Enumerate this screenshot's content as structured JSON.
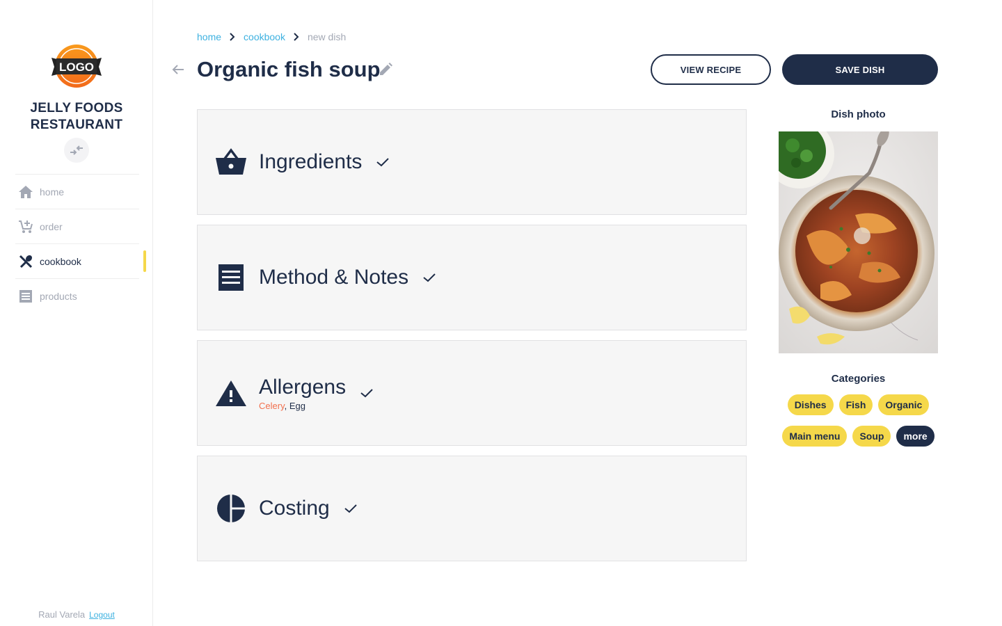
{
  "brand": {
    "logo_text": "LOGO",
    "name_line1": "JELLY FOODS",
    "name_line2": "RESTAURANT"
  },
  "sidebar": {
    "items": [
      {
        "label": "home",
        "icon": "home-icon",
        "active": false
      },
      {
        "label": "order",
        "icon": "cart-add-icon",
        "active": false
      },
      {
        "label": "cookbook",
        "icon": "utensils-icon",
        "active": true
      },
      {
        "label": "products",
        "icon": "receipt-icon",
        "active": false
      }
    ],
    "user_name": "Raul Varela",
    "logout_label": "Logout"
  },
  "breadcrumb": [
    "home",
    "cookbook",
    "new dish"
  ],
  "header": {
    "title": "Organic fish soup",
    "view_recipe_label": "VIEW RECIPE",
    "save_dish_label": "SAVE DISH"
  },
  "sections": [
    {
      "title": "Ingredients",
      "icon": "basket-icon",
      "complete": true
    },
    {
      "title": "Method & Notes",
      "icon": "receipt-icon",
      "complete": true
    },
    {
      "title": "Allergens",
      "icon": "warning-icon",
      "complete": true,
      "allergens": [
        {
          "name": "Celery",
          "highlight": true
        },
        {
          "name": "Egg",
          "highlight": false
        }
      ],
      "separator": ", "
    },
    {
      "title": "Costing",
      "icon": "pie-chart-icon",
      "complete": true
    }
  ],
  "side_panel": {
    "photo_heading": "Dish photo",
    "categories_heading": "Categories",
    "categories": [
      "Dishes",
      "Fish",
      "Organic",
      "Main menu",
      "Soup"
    ],
    "more_label": "more"
  },
  "colors": {
    "navy": "#1f2d48",
    "accent_yellow": "#f5d84a",
    "link_blue": "#3db1e0",
    "muted_gray": "#a3a8b4",
    "allergen_highlight": "#f2704e",
    "logo_orange": "#f7821b"
  }
}
